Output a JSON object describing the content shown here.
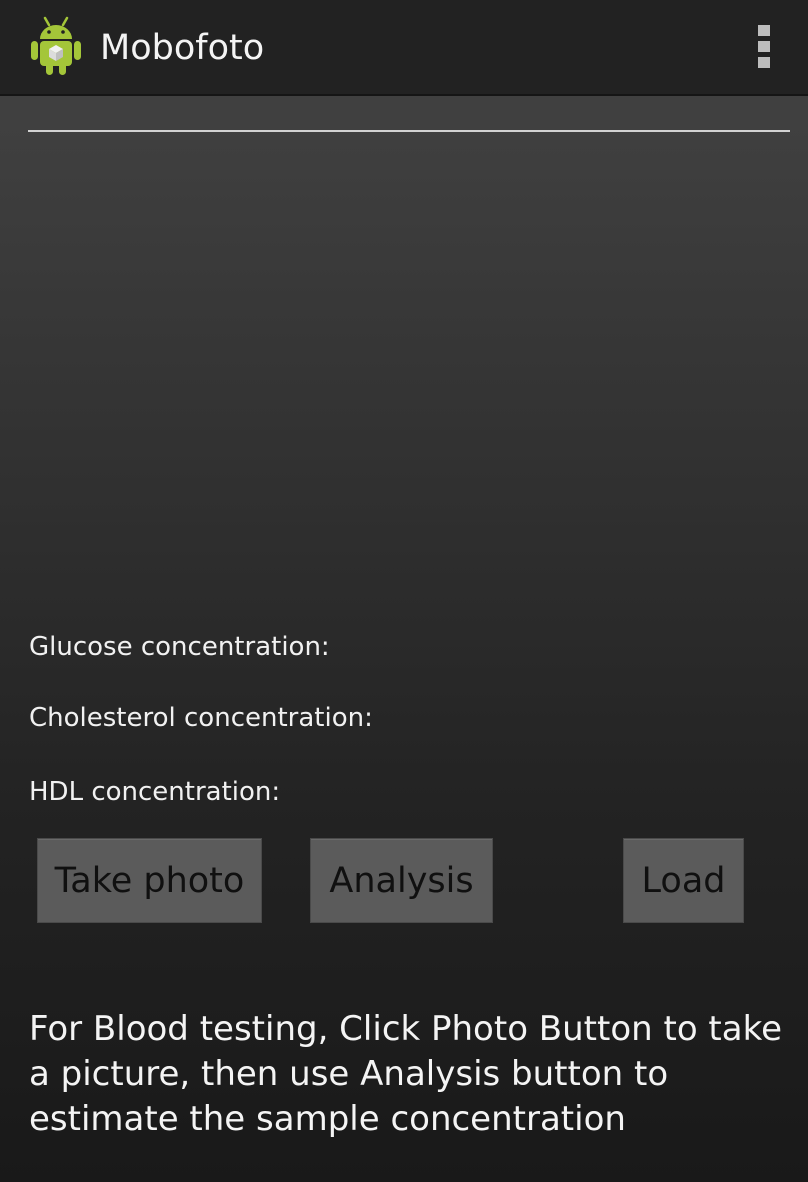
{
  "action_bar": {
    "title": "Mobofoto",
    "icon": "android-robot-icon",
    "overflow_icon": "more-vertical-icon"
  },
  "input": {
    "value": ""
  },
  "results": {
    "glucose_label": "Glucose concentration:",
    "cholesterol_label": "Cholesterol concentration:",
    "hdl_label": "HDL concentration:"
  },
  "buttons": {
    "take_photo": "Take photo",
    "analysis": "Analysis",
    "load": "Load"
  },
  "instructions": "For Blood testing, Click Photo Button to take a picture, then use Analysis button to estimate the sample concentration",
  "colors": {
    "android_green": "#a4c639",
    "button_bg": "#5b5b5b"
  }
}
